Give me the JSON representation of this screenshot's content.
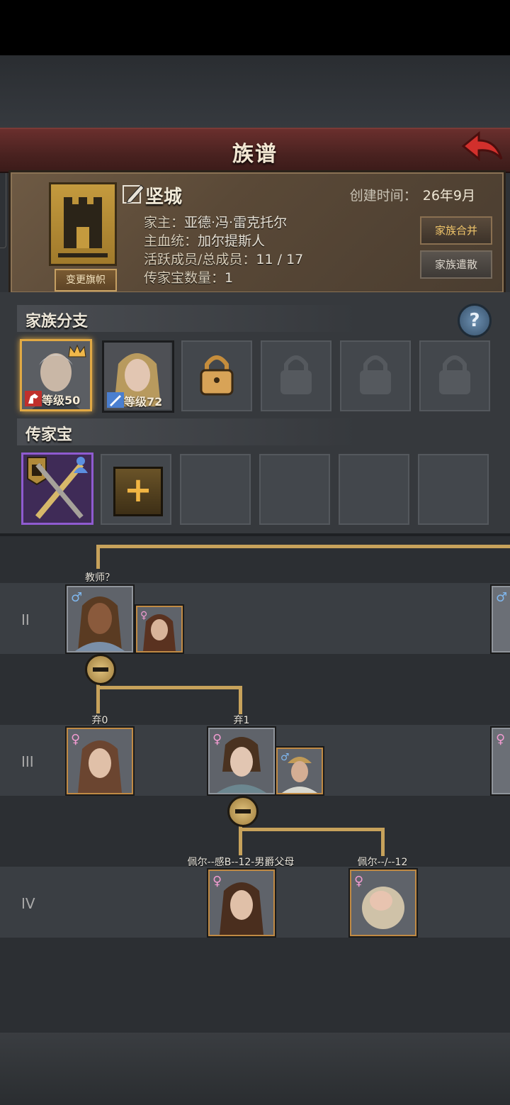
{
  "header": {
    "title": "族谱"
  },
  "family": {
    "name": "坚城",
    "created_label": "创建时间：",
    "created_value": "26年9月",
    "head_label": "家主：",
    "head_value": "亚德·冯·雷克托尔",
    "bloodline_label": "主血统：",
    "bloodline_value": "加尔提斯人",
    "members_label": "活跃成员/总成员：",
    "members_value": "11 / 17",
    "heirloom_label": "传家宝数量：",
    "heirloom_value": "1",
    "change_banner": "变更旗帜",
    "merge_button": "家族合并",
    "disband_button": "家族遣散"
  },
  "branches": {
    "title": "家族分支",
    "help": "?",
    "slots": [
      {
        "level": "等级50",
        "state": "active"
      },
      {
        "level": "等级72",
        "state": "active"
      },
      {
        "state": "unlockable"
      },
      {
        "state": "locked"
      },
      {
        "state": "locked"
      },
      {
        "state": "locked"
      }
    ]
  },
  "heirlooms": {
    "title": "传家宝",
    "add": "+"
  },
  "tree": {
    "generations": [
      "II",
      "III",
      "IV"
    ],
    "names": {
      "g2_main": "教师？",
      "g3_a": "弃0",
      "g3_b": "弃1",
      "g4_a": "佩尔--感B--12-男爵父母",
      "g4_b": "佩尔--/--12"
    },
    "gender_symbols": {
      "male": "♂",
      "female": "♀"
    }
  },
  "colors": {
    "accent_gold": "#c7a25b",
    "title_red": "#4a2220"
  }
}
